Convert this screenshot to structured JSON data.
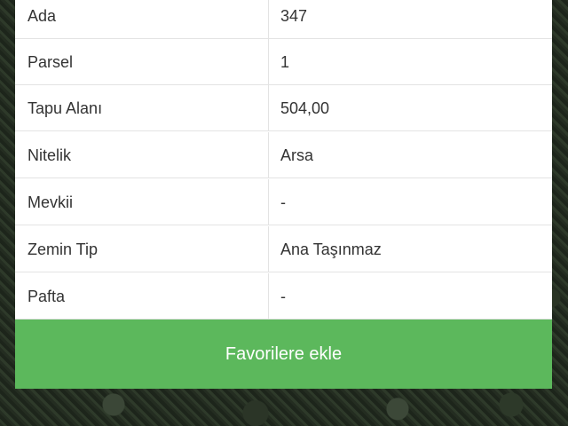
{
  "details": {
    "rows": [
      {
        "label": "Ada",
        "value": "347"
      },
      {
        "label": "Parsel",
        "value": "1"
      },
      {
        "label": "Tapu Alanı",
        "value": "504,00"
      },
      {
        "label": "Nitelik",
        "value": "Arsa"
      },
      {
        "label": "Mevkii",
        "value": "-"
      },
      {
        "label": "Zemin Tip",
        "value": "Ana Taşınmaz"
      },
      {
        "label": "Pafta",
        "value": "-"
      }
    ]
  },
  "actions": {
    "favorite_label": "Favorilere ekle",
    "favorite_color": "#5cb85c"
  }
}
